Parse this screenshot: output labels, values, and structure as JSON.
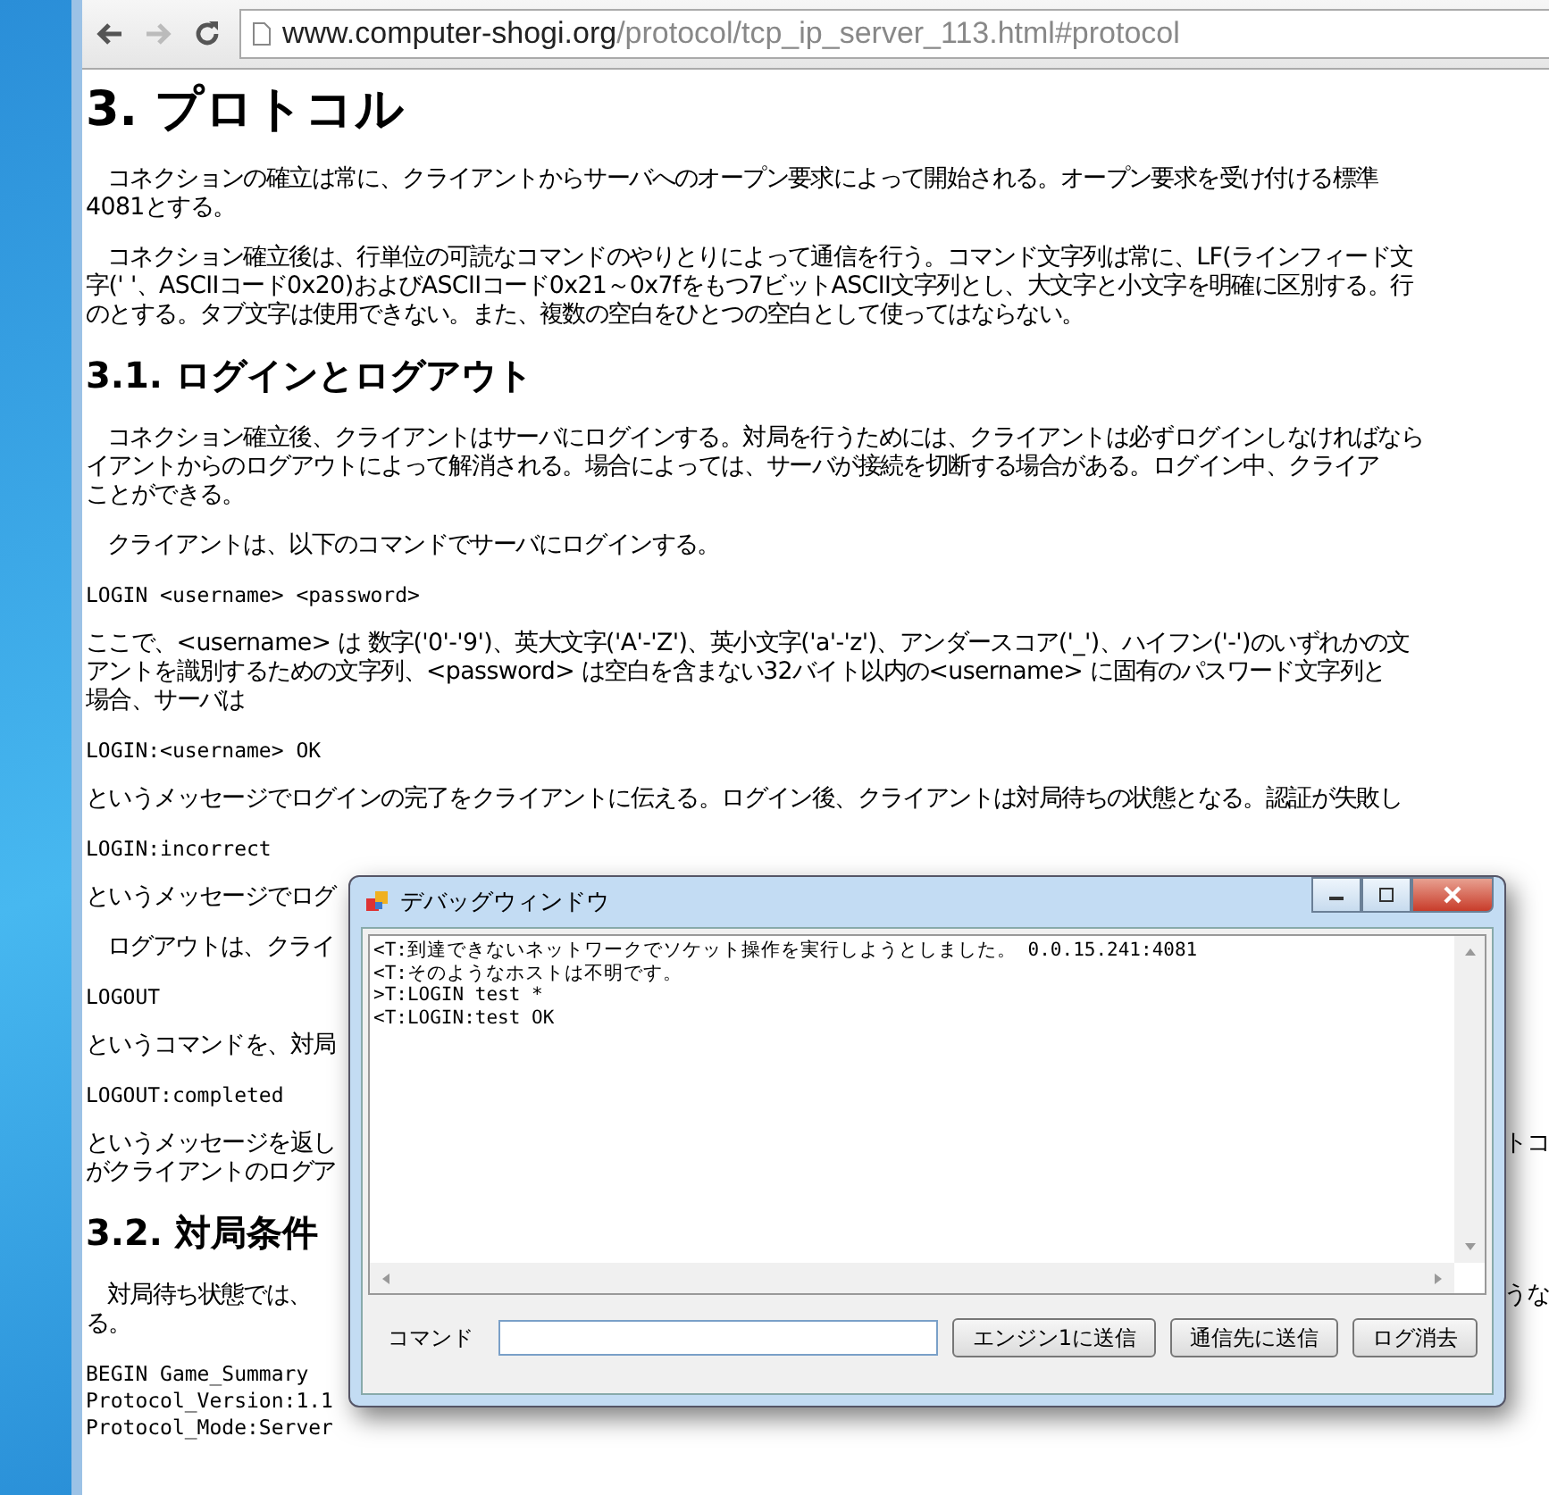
{
  "browser": {
    "url": {
      "host": "www.computer-shogi.org",
      "path": "/protocol/tcp_ip_server_113.html#protocol"
    }
  },
  "page": [
    {
      "kind": "h1",
      "text": "3. プロトコル"
    },
    {
      "kind": "p",
      "indent": true,
      "lines": [
        [
          "コネクションの確立は常に、クライアントからサーバへのオープン要求によって開始される。オープン要求を受け付ける標準"
        ],
        [
          "4081とする。"
        ]
      ]
    },
    {
      "kind": "p",
      "indent": true,
      "lines": [
        [
          "コネクション確立後は、行単位の可読なコマンドのやりとりによって通信を行う。コマンド文字列は常に、LF(ラインフィード文"
        ],
        [
          "字(' '、ASCIIコード0x20)およびASCIIコード0x21～0x7fをもつ7ビットASCII文字列とし、大文字と小文字を明確に区別する。行"
        ],
        [
          "のとする。タブ文字は使用できない。また、複数の空白をひとつの空白として使ってはならない。"
        ]
      ]
    },
    {
      "kind": "h2",
      "text": "3.1. ログインとログアウト"
    },
    {
      "kind": "p",
      "indent": true,
      "lines": [
        [
          "コネクション確立後、クライアントはサーバにログインする。対局を行うためには、クライアントは必ずログインしなければなら"
        ],
        [
          "イアントからのログアウトによって解消される。場合によっては、サーバが接続を切断する場合がある。ログイン中、クライア"
        ],
        [
          "ことができる。"
        ]
      ]
    },
    {
      "kind": "p",
      "indent": true,
      "lines": [
        [
          "クライアントは、以下のコマンドでサーバにログインする。"
        ]
      ]
    },
    {
      "kind": "code",
      "lines": [
        "LOGIN <username> <password>"
      ]
    },
    {
      "kind": "p",
      "indent": false,
      "lines": [
        [
          "ここで、<username> は 数字('0'-'9')、英大文字('A'-'Z')、英小文字('a'-'z')、アンダースコア('_')、ハイフン('-')のいずれかの文"
        ],
        [
          "アントを識別するための文字列、<password> は空白を含まない32バイト以内の<username> に固有のパスワード文字列と"
        ],
        [
          "場合、サーバは"
        ]
      ]
    },
    {
      "kind": "code",
      "lines": [
        "LOGIN:<username> OK"
      ]
    },
    {
      "kind": "p",
      "indent": false,
      "lines": [
        [
          "というメッセージでログインの完了をクライアントに伝える。ログイン後、クライアントは対局待ちの状態となる。認証が失敗し"
        ]
      ]
    },
    {
      "kind": "code",
      "lines": [
        "LOGIN:incorrect"
      ]
    },
    {
      "kind": "p",
      "indent": false,
      "lines": [
        [
          "というメッセージでログ"
        ]
      ]
    },
    {
      "kind": "p",
      "indent": true,
      "lines": [
        [
          "ログアウトは、クライ"
        ]
      ]
    },
    {
      "kind": "code",
      "lines": [
        "LOGOUT"
      ]
    },
    {
      "kind": "p",
      "indent": false,
      "lines": [
        [
          "というコマンドを、対局"
        ]
      ]
    },
    {
      "kind": "code",
      "lines": [
        "LOGOUT:completed"
      ]
    },
    {
      "kind": "p",
      "indent": false,
      "lines": [
        [
          "というメッセージを返し",
          "トコ"
        ],
        [
          "がクライアントのログア"
        ]
      ]
    },
    {
      "kind": "h2",
      "text": "3.2. 対局条件"
    },
    {
      "kind": "p",
      "indent": true,
      "lines": [
        [
          "対局待ち状態では、",
          "うな"
        ],
        [
          "る。"
        ]
      ]
    },
    {
      "kind": "code",
      "lines": [
        "BEGIN Game_Summary",
        "Protocol_Version:1.1",
        "Protocol_Mode:Server"
      ]
    }
  ],
  "dialog": {
    "title": "デバッグウィンドウ",
    "log": [
      "<T:到達できないネットワークでソケット操作を実行しようとしました。 0.0.15.241:4081",
      "<T:そのようなホストは不明です。",
      ">T:LOGIN test *",
      "<T:LOGIN:test OK"
    ],
    "command_label": "コマンド",
    "buttons": [
      "エンジン1に送信",
      "通信先に送信",
      "ログ消去"
    ]
  }
}
